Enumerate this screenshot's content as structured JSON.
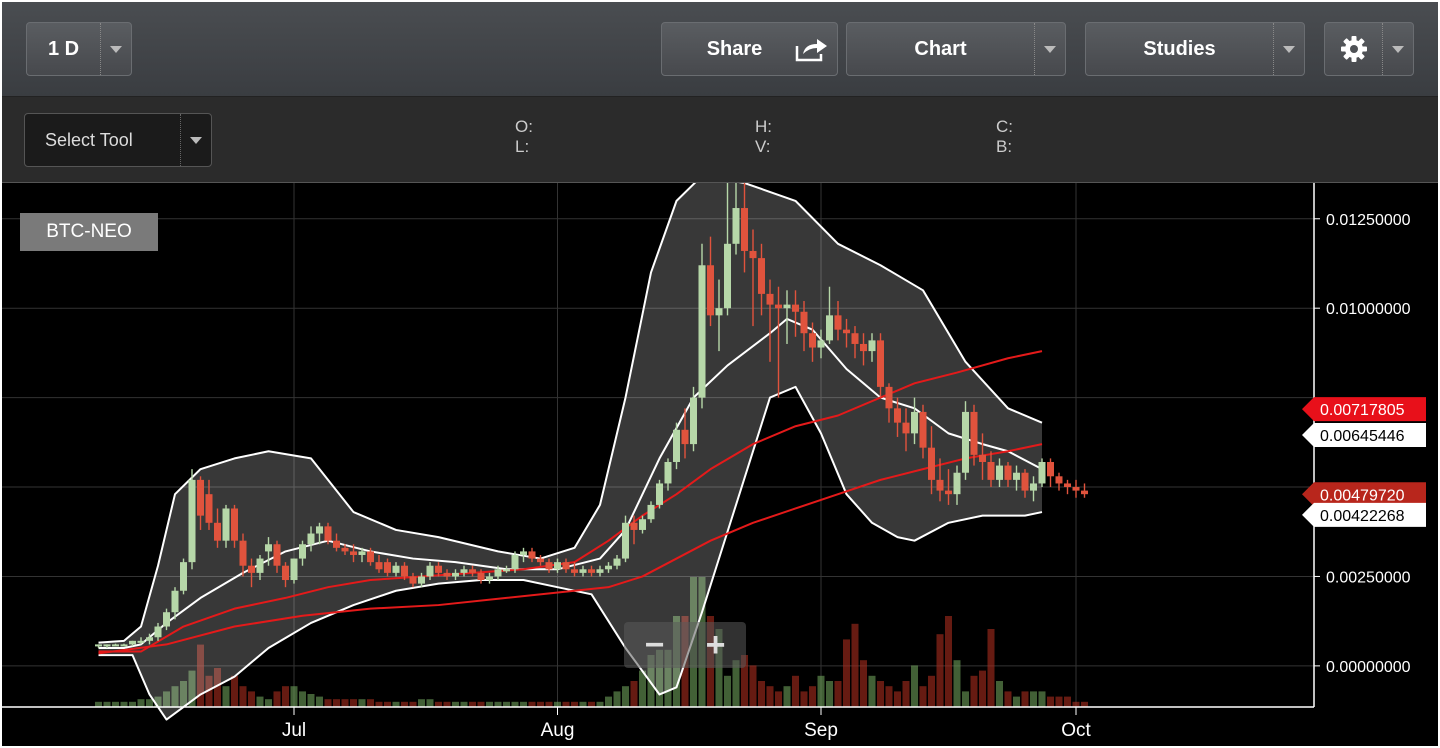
{
  "toolbar": {
    "interval_label": "1 D",
    "share_label": "Share",
    "chart_label": "Chart",
    "studies_label": "Studies",
    "settings_icon": "gear-icon",
    "share_icon": "share-icon"
  },
  "subbar": {
    "select_tool_label": "Select Tool",
    "ohlc": {
      "o": "O:",
      "l": "L:",
      "h": "H:",
      "v": "V:",
      "c": "C:",
      "b": "B:"
    }
  },
  "zoom": {
    "minus": "−",
    "plus": "+"
  },
  "colors": {
    "up": "#b6d7a8",
    "down": "#e0533d",
    "ma": "#e41a1a",
    "band": "#ffffff",
    "background": "#000000"
  },
  "chart_data": {
    "type": "candlestick",
    "symbol": "BTC-NEO",
    "x_labels": [
      "Jul",
      "Aug",
      "Sep",
      "Oct"
    ],
    "x_tick_days": [
      31,
      62,
      93,
      123
    ],
    "day_range": [
      8,
      139
    ],
    "y_ticks": [
      "0.01250000",
      "0.01000000",
      "0.00250000",
      "0.00000000"
    ],
    "y_tick_values": [
      0.0125,
      0.01,
      0.0025,
      0.0
    ],
    "ylim": [
      -0.00115,
      0.0135
    ],
    "grid": true,
    "price_labels": [
      {
        "value": 0.00717805,
        "text": "0.00717805",
        "style": "red"
      },
      {
        "value": 0.00645446,
        "text": "0.00645446",
        "style": "white"
      },
      {
        "value": 0.0047972,
        "text": "0.00479720",
        "style": "darkred"
      },
      {
        "value": 0.00422268,
        "text": "0.00422268",
        "style": "white"
      }
    ],
    "candles": [
      [
        0.00055,
        0.0006,
        0.0005,
        0.0006
      ],
      [
        0.0006,
        0.0006,
        0.0005,
        0.0006
      ],
      [
        0.0006,
        0.00062,
        0.00055,
        0.0006
      ],
      [
        0.0006,
        0.00062,
        0.00055,
        0.0006
      ],
      [
        0.0006,
        0.0007,
        0.00055,
        0.0007
      ],
      [
        0.0007,
        0.0008,
        0.0006,
        0.0007
      ],
      [
        0.0007,
        0.0009,
        0.0006,
        0.0008
      ],
      [
        0.0008,
        0.0012,
        0.0007,
        0.0011
      ],
      [
        0.0011,
        0.0016,
        0.001,
        0.0015
      ],
      [
        0.0015,
        0.0022,
        0.0013,
        0.0021
      ],
      [
        0.0021,
        0.003,
        0.002,
        0.0029
      ],
      [
        0.0029,
        0.0055,
        0.0027,
        0.0052
      ],
      [
        0.0052,
        0.0053,
        0.0038,
        0.0042
      ],
      [
        0.0048,
        0.0052,
        0.0038,
        0.004
      ],
      [
        0.004,
        0.0044,
        0.0033,
        0.0035
      ],
      [
        0.0035,
        0.0045,
        0.0033,
        0.0044
      ],
      [
        0.0044,
        0.0045,
        0.0033,
        0.0035
      ],
      [
        0.0035,
        0.0037,
        0.0025,
        0.0028
      ],
      [
        0.0028,
        0.003,
        0.0022,
        0.0026
      ],
      [
        0.0026,
        0.0031,
        0.0024,
        0.003
      ],
      [
        0.0032,
        0.0036,
        0.0028,
        0.0034
      ],
      [
        0.0034,
        0.0035,
        0.0026,
        0.0028
      ],
      [
        0.0028,
        0.0029,
        0.0022,
        0.0024
      ],
      [
        0.0024,
        0.003,
        0.0023,
        0.003
      ],
      [
        0.003,
        0.0035,
        0.0028,
        0.0034
      ],
      [
        0.0034,
        0.0039,
        0.0032,
        0.0037
      ],
      [
        0.0037,
        0.004,
        0.0034,
        0.0039
      ],
      [
        0.0039,
        0.004,
        0.0034,
        0.0035
      ],
      [
        0.0035,
        0.0037,
        0.0032,
        0.0033
      ],
      [
        0.0033,
        0.0034,
        0.0031,
        0.0032
      ],
      [
        0.0032,
        0.0034,
        0.0029,
        0.0031
      ],
      [
        0.0031,
        0.0033,
        0.0029,
        0.0032
      ],
      [
        0.0032,
        0.0033,
        0.0028,
        0.0029
      ],
      [
        0.0029,
        0.0031,
        0.0026,
        0.0027
      ],
      [
        0.0029,
        0.003,
        0.0025,
        0.0026
      ],
      [
        0.0026,
        0.0029,
        0.0025,
        0.0028
      ],
      [
        0.0028,
        0.0029,
        0.0024,
        0.0025
      ],
      [
        0.0025,
        0.0026,
        0.0022,
        0.0023
      ],
      [
        0.0023,
        0.0026,
        0.0022,
        0.0025
      ],
      [
        0.0025,
        0.0029,
        0.0024,
        0.0028
      ],
      [
        0.0028,
        0.0029,
        0.0025,
        0.0026
      ],
      [
        0.0026,
        0.0027,
        0.0024,
        0.0025
      ],
      [
        0.0025,
        0.0027,
        0.0024,
        0.0026
      ],
      [
        0.0026,
        0.0028,
        0.0025,
        0.0027
      ],
      [
        0.0027,
        0.0028,
        0.0025,
        0.0026
      ],
      [
        0.0026,
        0.0027,
        0.0023,
        0.0024
      ],
      [
        0.0024,
        0.0026,
        0.0023,
        0.0025
      ],
      [
        0.0025,
        0.0028,
        0.0024,
        0.0027
      ],
      [
        0.0027,
        0.0028,
        0.0026,
        0.0027
      ],
      [
        0.0027,
        0.0032,
        0.0026,
        0.0031
      ],
      [
        0.0031,
        0.0033,
        0.0029,
        0.0032
      ],
      [
        0.0032,
        0.0033,
        0.0029,
        0.003
      ],
      [
        0.003,
        0.0031,
        0.0028,
        0.0029
      ],
      [
        0.0029,
        0.003,
        0.0026,
        0.0027
      ],
      [
        0.0027,
        0.003,
        0.0026,
        0.0029
      ],
      [
        0.0029,
        0.003,
        0.0026,
        0.0027
      ],
      [
        0.0027,
        0.0029,
        0.0025,
        0.0026
      ],
      [
        0.0026,
        0.0028,
        0.0025,
        0.0027
      ],
      [
        0.0027,
        0.0028,
        0.0025,
        0.0026
      ],
      [
        0.0026,
        0.0028,
        0.0025,
        0.0027
      ],
      [
        0.0027,
        0.0029,
        0.0026,
        0.0028
      ],
      [
        0.0028,
        0.0031,
        0.0027,
        0.003
      ],
      [
        0.003,
        0.0042,
        0.0029,
        0.004
      ],
      [
        0.004,
        0.0042,
        0.0034,
        0.0038
      ],
      [
        0.0038,
        0.0042,
        0.0037,
        0.0041
      ],
      [
        0.0041,
        0.0046,
        0.004,
        0.0045
      ],
      [
        0.0045,
        0.0052,
        0.0044,
        0.0051
      ],
      [
        0.0051,
        0.0058,
        0.0049,
        0.0057
      ],
      [
        0.0057,
        0.0068,
        0.0055,
        0.0066
      ],
      [
        0.0066,
        0.0072,
        0.0058,
        0.0062
      ],
      [
        0.0062,
        0.0078,
        0.006,
        0.0075
      ],
      [
        0.0075,
        0.0118,
        0.0072,
        0.0112
      ],
      [
        0.0112,
        0.012,
        0.0095,
        0.0098
      ],
      [
        0.0098,
        0.0108,
        0.0088,
        0.01
      ],
      [
        0.01,
        0.0135,
        0.0098,
        0.0118
      ],
      [
        0.0118,
        0.0135,
        0.0115,
        0.0128
      ],
      [
        0.0128,
        0.0135,
        0.011,
        0.0116
      ],
      [
        0.0116,
        0.0122,
        0.0095,
        0.0114
      ],
      [
        0.0114,
        0.0118,
        0.0098,
        0.0104
      ],
      [
        0.0104,
        0.0108,
        0.0085,
        0.0101
      ],
      [
        0.0101,
        0.0106,
        0.0075,
        0.01
      ],
      [
        0.01,
        0.0105,
        0.009,
        0.0101
      ],
      [
        0.0101,
        0.0105,
        0.0092,
        0.0099
      ],
      [
        0.0099,
        0.0102,
        0.0088,
        0.0093
      ],
      [
        0.0093,
        0.0096,
        0.0085,
        0.0089
      ],
      [
        0.0089,
        0.0094,
        0.0086,
        0.0091
      ],
      [
        0.0091,
        0.0106,
        0.009,
        0.0098
      ],
      [
        0.0098,
        0.0102,
        0.0091,
        0.0094
      ],
      [
        0.0094,
        0.0097,
        0.0089,
        0.0093
      ],
      [
        0.0093,
        0.0095,
        0.0086,
        0.009
      ],
      [
        0.009,
        0.0093,
        0.0084,
        0.0088
      ],
      [
        0.0088,
        0.0093,
        0.0085,
        0.0091
      ],
      [
        0.0091,
        0.0093,
        0.0075,
        0.0078
      ],
      [
        0.0078,
        0.0079,
        0.0068,
        0.0072
      ],
      [
        0.0072,
        0.0075,
        0.0064,
        0.0068
      ],
      [
        0.0068,
        0.0072,
        0.006,
        0.0065
      ],
      [
        0.0065,
        0.0075,
        0.0062,
        0.0071
      ],
      [
        0.0071,
        0.0073,
        0.0058,
        0.0061
      ],
      [
        0.0061,
        0.0067,
        0.0048,
        0.0052
      ],
      [
        0.0052,
        0.0058,
        0.0046,
        0.0049
      ],
      [
        0.0049,
        0.0055,
        0.0045,
        0.0048
      ],
      [
        0.0048,
        0.0056,
        0.0045,
        0.0054
      ],
      [
        0.0054,
        0.0074,
        0.0052,
        0.0071
      ],
      [
        0.0071,
        0.0073,
        0.0056,
        0.0059
      ],
      [
        0.0059,
        0.0065,
        0.0052,
        0.0057
      ],
      [
        0.0057,
        0.006,
        0.005,
        0.0052
      ],
      [
        0.0052,
        0.0058,
        0.005,
        0.0056
      ],
      [
        0.0056,
        0.0057,
        0.005,
        0.0052
      ],
      [
        0.0052,
        0.0056,
        0.0049,
        0.0054
      ],
      [
        0.0054,
        0.0055,
        0.0047,
        0.0049
      ],
      [
        0.0049,
        0.0053,
        0.0046,
        0.0051
      ],
      [
        0.0051,
        0.0058,
        0.005,
        0.0057
      ],
      [
        0.0057,
        0.0058,
        0.005,
        0.0053
      ],
      [
        0.0053,
        0.0054,
        0.0049,
        0.0051
      ],
      [
        0.0051,
        0.0052,
        0.0048,
        0.005
      ],
      [
        0.005,
        0.0052,
        0.0047,
        0.0049
      ],
      [
        0.0049,
        0.0051,
        0.0047,
        0.0048
      ]
    ],
    "upper_band": [
      [
        8,
        0.00065
      ],
      [
        11,
        0.0007
      ],
      [
        13,
        0.0011
      ],
      [
        15,
        0.0028
      ],
      [
        17,
        0.0048
      ],
      [
        20,
        0.0055
      ],
      [
        24,
        0.0058
      ],
      [
        28,
        0.006
      ],
      [
        33,
        0.0058
      ],
      [
        38,
        0.0043
      ],
      [
        43,
        0.0038
      ],
      [
        48,
        0.0036
      ],
      [
        55,
        0.0032
      ],
      [
        60,
        0.003
      ],
      [
        64,
        0.0033
      ],
      [
        67,
        0.0045
      ],
      [
        70,
        0.0075
      ],
      [
        73,
        0.011
      ],
      [
        76,
        0.013
      ],
      [
        79,
        0.0137
      ],
      [
        84,
        0.0135
      ],
      [
        90,
        0.013
      ],
      [
        95,
        0.0118
      ],
      [
        100,
        0.0112
      ],
      [
        105,
        0.0105
      ],
      [
        110,
        0.0085
      ],
      [
        115,
        0.0072
      ],
      [
        119,
        0.0068
      ]
    ],
    "mid_band": [
      [
        8,
        0.0005
      ],
      [
        11,
        0.0005
      ],
      [
        13,
        0.0006
      ],
      [
        16,
        0.0012
      ],
      [
        20,
        0.0019
      ],
      [
        25,
        0.0026
      ],
      [
        30,
        0.0032
      ],
      [
        35,
        0.0035
      ],
      [
        40,
        0.0032
      ],
      [
        45,
        0.003
      ],
      [
        50,
        0.0029
      ],
      [
        56,
        0.0027
      ],
      [
        62,
        0.0027
      ],
      [
        67,
        0.003
      ],
      [
        70,
        0.0038
      ],
      [
        74,
        0.0058
      ],
      [
        78,
        0.0075
      ],
      [
        82,
        0.0084
      ],
      [
        87,
        0.0093
      ],
      [
        89,
        0.0097
      ],
      [
        92,
        0.0094
      ],
      [
        96,
        0.0083
      ],
      [
        100,
        0.0075
      ],
      [
        104,
        0.0072
      ],
      [
        108,
        0.0065
      ],
      [
        112,
        0.0062
      ],
      [
        115,
        0.006
      ],
      [
        119,
        0.0055
      ]
    ],
    "lower_band": [
      [
        8,
        0.0003
      ],
      [
        12,
        0.0003
      ],
      [
        14,
        -0.0008
      ],
      [
        16,
        -0.0015
      ],
      [
        20,
        -0.0008
      ],
      [
        24,
        -0.0003
      ],
      [
        28,
        0.0005
      ],
      [
        33,
        0.0012
      ],
      [
        38,
        0.0017
      ],
      [
        43,
        0.0021
      ],
      [
        48,
        0.0023
      ],
      [
        53,
        0.0024
      ],
      [
        58,
        0.0024
      ],
      [
        62,
        0.0022
      ],
      [
        66,
        0.002
      ],
      [
        70,
        0.0005
      ],
      [
        74,
        -0.0008
      ],
      [
        76,
        -0.0006
      ],
      [
        79,
        0.0015
      ],
      [
        83,
        0.0045
      ],
      [
        87,
        0.0075
      ],
      [
        90,
        0.0078
      ],
      [
        93,
        0.0065
      ],
      [
        96,
        0.0048
      ],
      [
        99,
        0.004
      ],
      [
        102,
        0.0036
      ],
      [
        104,
        0.0035
      ],
      [
        108,
        0.004
      ],
      [
        112,
        0.0042
      ],
      [
        117,
        0.0042
      ],
      [
        119,
        0.0043
      ]
    ],
    "ma_fast": [
      [
        8,
        0.0004
      ],
      [
        13,
        0.0004
      ],
      [
        18,
        0.0011
      ],
      [
        24,
        0.0016
      ],
      [
        30,
        0.0019
      ],
      [
        35,
        0.0022
      ],
      [
        40,
        0.0024
      ],
      [
        46,
        0.0025
      ],
      [
        52,
        0.0026
      ],
      [
        58,
        0.0027
      ],
      [
        64,
        0.0029
      ],
      [
        68,
        0.0035
      ],
      [
        72,
        0.0042
      ],
      [
        76,
        0.0048
      ],
      [
        80,
        0.0055
      ],
      [
        85,
        0.0062
      ],
      [
        90,
        0.0067
      ],
      [
        95,
        0.007
      ],
      [
        100,
        0.0075
      ],
      [
        104,
        0.0079
      ],
      [
        109,
        0.0082
      ],
      [
        115,
        0.0086
      ],
      [
        119,
        0.0088
      ]
    ],
    "ma_slow": [
      [
        8,
        0.00035
      ],
      [
        16,
        0.0006
      ],
      [
        24,
        0.0011
      ],
      [
        32,
        0.0014
      ],
      [
        40,
        0.0016
      ],
      [
        48,
        0.0017
      ],
      [
        56,
        0.0019
      ],
      [
        64,
        0.0021
      ],
      [
        68,
        0.0022
      ],
      [
        72,
        0.0025
      ],
      [
        76,
        0.003
      ],
      [
        80,
        0.0035
      ],
      [
        85,
        0.004
      ],
      [
        90,
        0.0044
      ],
      [
        95,
        0.0048
      ],
      [
        100,
        0.0052
      ],
      [
        105,
        0.0055
      ],
      [
        110,
        0.0058
      ],
      [
        115,
        0.006
      ],
      [
        119,
        0.0062
      ]
    ],
    "volume": [
      0.002,
      0.002,
      0.002,
      0.002,
      0.002,
      0.003,
      0.003,
      0.004,
      0.006,
      0.008,
      0.01,
      0.014,
      0.024,
      0.012,
      0.015,
      0.008,
      0.012,
      0.008,
      0.006,
      0.004,
      0.003,
      0.006,
      0.008,
      0.008,
      0.006,
      0.005,
      0.004,
      0.003,
      0.003,
      0.003,
      0.003,
      0.003,
      0.003,
      0.002,
      0.002,
      0.002,
      0.002,
      0.002,
      0.003,
      0.003,
      0.002,
      0.002,
      0.002,
      0.002,
      0.002,
      0.002,
      0.002,
      0.002,
      0.002,
      0.002,
      0.002,
      0.002,
      0.002,
      0.002,
      0.002,
      0.002,
      0.002,
      0.002,
      0.002,
      0.002,
      0.004,
      0.006,
      0.008,
      0.01,
      0.014,
      0.02,
      0.022,
      0.022,
      0.035,
      0.035,
      0.05,
      0.05,
      0.035,
      0.03,
      0.012,
      0.018,
      0.02,
      0.016,
      0.01,
      0.008,
      0.006,
      0.008,
      0.012,
      0.006,
      0.008,
      0.012,
      0.01,
      0.01,
      0.026,
      0.032,
      0.018,
      0.012,
      0.01,
      0.008,
      0.006,
      0.01,
      0.016,
      0.008,
      0.012,
      0.028,
      0.035,
      0.018,
      0.006,
      0.012,
      0.014,
      0.03,
      0.01,
      0.006,
      0.004,
      0.006,
      0.006,
      0.006,
      0.004,
      0.004,
      0.004,
      0.002,
      0.002
    ]
  }
}
